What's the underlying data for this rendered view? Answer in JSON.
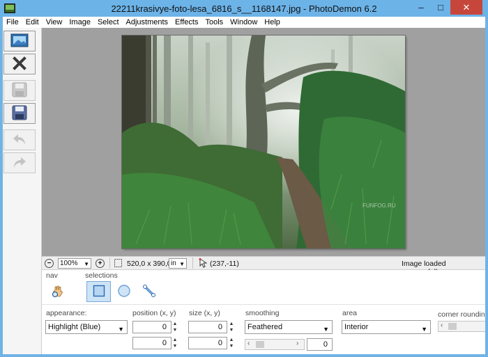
{
  "window": {
    "title": "22211krasivye-foto-lesa_6816_s__1168147.jpg  -  PhotoDemon 6.2",
    "min_glyph": "–",
    "max_glyph": "□",
    "close_glyph": "✕"
  },
  "menu": [
    "File",
    "Edit",
    "View",
    "Image",
    "Select",
    "Adjustments",
    "Effects",
    "Tools",
    "Window",
    "Help"
  ],
  "toolbar_left": [
    {
      "name": "open-image-icon",
      "enabled": true
    },
    {
      "name": "close-image-icon",
      "enabled": true
    },
    {
      "name": "save-icon",
      "enabled": false
    },
    {
      "name": "save-as-icon",
      "enabled": true
    },
    {
      "name": "undo-icon",
      "enabled": false
    },
    {
      "name": "redo-icon",
      "enabled": false
    }
  ],
  "image": {
    "watermark": "FUNFOG.RU"
  },
  "status": {
    "zoom": "100%",
    "size": "520,0 x 390,0",
    "unit": "in",
    "cursor": "(237,-11)",
    "message": "Image loaded successfully."
  },
  "tools": {
    "nav_label": "nav",
    "selections_label": "selections",
    "active_tool": "rectangular-selection"
  },
  "options": {
    "appearance_label": "appearance:",
    "appearance_value": "Highlight (Blue)",
    "position_label": "position (x, y)",
    "position_x": "0",
    "position_y": "0",
    "size_label": "size (x, y)",
    "size_x": "0",
    "size_y": "0",
    "smoothing_label": "smoothing",
    "smoothing_value": "Feathered",
    "feather_value": "0",
    "area_label": "area",
    "area_value": "Interior",
    "corner_label": "corner rounding"
  },
  "colors": {
    "titlebar": "#6cb3e8",
    "close": "#c7463b",
    "canvas": "#a0a0a0",
    "accent": "#3a8fd8"
  }
}
